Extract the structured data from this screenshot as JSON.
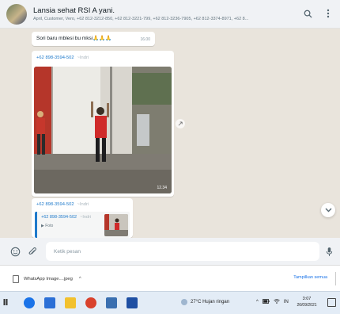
{
  "header": {
    "title": "Lansia sehat RSI A yani.",
    "members": "April, Customer, Vero, +62 812-3212-850, +62 812-3221-799, +62 812-3236-7905, +62 812-3374-8971, +62 8..."
  },
  "messages": {
    "text_msg": {
      "text": "Sori baru mblesi bu  mksi🙏🙏🙏",
      "time": "16.00"
    },
    "image_msg": {
      "sender_phone": "+62 898-3594-502",
      "sender_name": "~Indri",
      "duration": "12.34"
    },
    "reply_msg": {
      "sender_phone": "+62 898-3594-502",
      "sender_name": "~Indri",
      "quote_sender_phone": "+62 898-3594-502",
      "quote_sender_name": "~Indri",
      "quote_text": "▶ Foto"
    }
  },
  "composer": {
    "placeholder": "Ketik pesan"
  },
  "downloads": {
    "file_name": "WhatsApp Image....jpeg",
    "caret": "^",
    "show_all": "Tampilkan semua"
  },
  "taskbar": {
    "weather": "27°C  Hujan ringan",
    "tray_caret": "^",
    "tray_lang": "IN",
    "time": "3:07",
    "date": "26/09/2021"
  },
  "colors": {
    "accent_blue": "#1f7acb",
    "header_bg": "#f0f2f5",
    "chat_bg": "#e9e4dc"
  }
}
